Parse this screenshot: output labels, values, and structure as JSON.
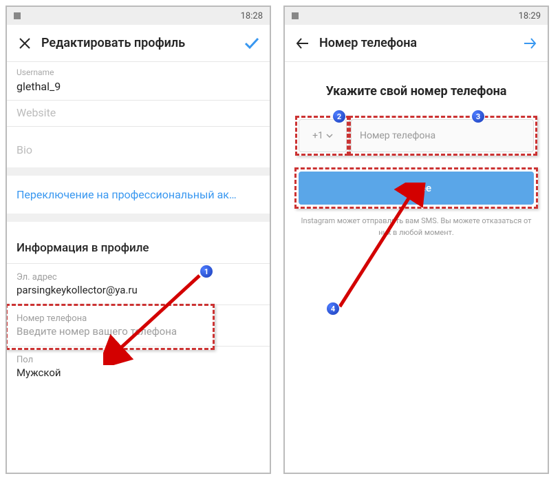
{
  "left": {
    "status_time": "18:28",
    "header_title": "Редактировать профиль",
    "fields": {
      "username_label": "Username",
      "username_value": "glethal_9",
      "website_label": "Website",
      "bio_label": "Bio"
    },
    "switch_link": "Переключение на профессиональный ак…",
    "info_section_title": "Информация в профиле",
    "email_label": "Эл. адрес",
    "email_value": "parsingkeykollector@ya.ru",
    "phone_label": "Номер телефона",
    "phone_placeholder": "Введите номер вашего телефона",
    "gender_label": "Пол",
    "gender_value": "Мужской"
  },
  "right": {
    "status_time": "18:29",
    "header_title": "Номер телефона",
    "heading": "Укажите свой номер телефона",
    "country_code": "+1",
    "phone_placeholder": "Номер телефона",
    "next_btn": "Далее",
    "sms_note": "Instagram может отправлять вам SMS. Вы можете отказаться от них в любой момент."
  },
  "badges": {
    "b1": "1",
    "b2": "2",
    "b3": "3",
    "b4": "4"
  }
}
